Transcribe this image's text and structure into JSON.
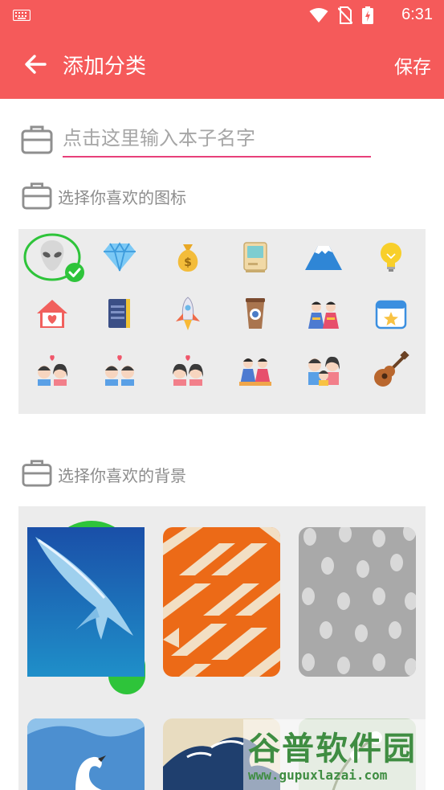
{
  "status_bar": {
    "time": "6:31"
  },
  "app_bar": {
    "title": "添加分类",
    "save_label": "保存"
  },
  "name_input": {
    "placeholder": "点击这里输入本子名字",
    "value": ""
  },
  "icons_section": {
    "label": "选择你喜欢的图标",
    "selected_index": 0,
    "icons": [
      "alien-icon",
      "diamond-icon",
      "money-bag-icon",
      "retro-computer-icon",
      "mountain-icon",
      "lightbulb-icon",
      "house-heart-icon",
      "notebook-icon",
      "rocket-icon",
      "coffee-cup-icon",
      "dolls-icon",
      "calendar-star-icon",
      "couple-icon",
      "two-boys-icon",
      "two-girls-icon",
      "doll-couple-icon",
      "family-icon",
      "guitar-icon"
    ]
  },
  "backgrounds_section": {
    "label": "选择你喜欢的背景",
    "selected_index": 0,
    "backgrounds": [
      "whale-background",
      "orange-geometric-background",
      "gray-dots-background",
      "swan-background",
      "great-wave-background",
      "floral-background"
    ]
  },
  "watermark": {
    "title": "谷普软件园",
    "url": "www.gupuxlazai.com"
  },
  "colors": {
    "primary": "#f55a5a",
    "accent": "#e8407a",
    "selected": "#2ec43a",
    "panel": "#ececec"
  }
}
